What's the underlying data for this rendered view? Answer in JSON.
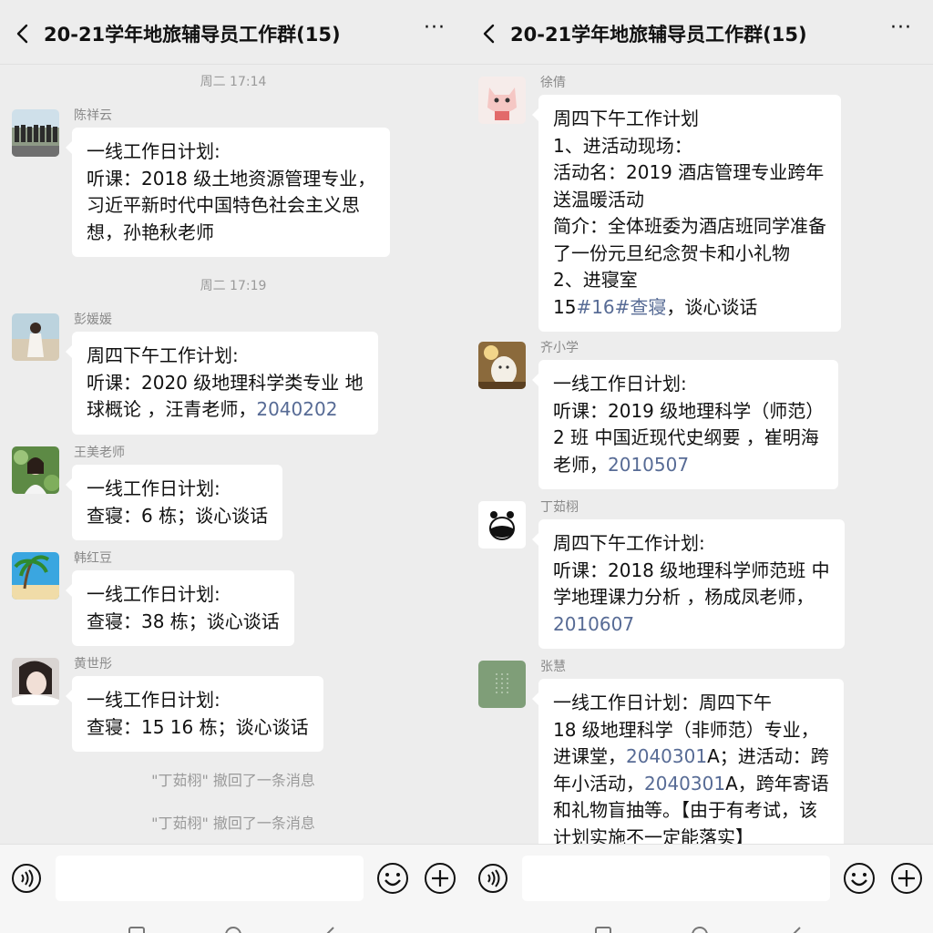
{
  "left": {
    "header": {
      "title": "20-21学年地旅辅导员工作群(15)",
      "more": "···"
    },
    "times": [
      "周二 17:14",
      "周二 17:19"
    ],
    "messages": [
      {
        "sender": "陈祥云",
        "lines": [
          [
            {
              "t": "一线工作日计划:"
            }
          ],
          [
            {
              "t": "听课：2018 级土地资源管理专业，"
            }
          ],
          [
            {
              "t": "习近平新时代中国特色社会主义思"
            }
          ],
          [
            {
              "t": "想，孙艳秋老师"
            }
          ]
        ]
      },
      {
        "sender": "彭媛媛",
        "lines": [
          [
            {
              "t": "周四下午工作计划:"
            }
          ],
          [
            {
              "t": "听课：2020 级地理科学类专业  地"
            }
          ],
          [
            {
              "t": "球概论  ，汪青老师，"
            },
            {
              "t": "2040202",
              "link": true
            }
          ]
        ]
      },
      {
        "sender": "王美老师",
        "lines": [
          [
            {
              "t": "一线工作日计划:"
            }
          ],
          [
            {
              "t": "查寝：6 栋；谈心谈话"
            }
          ]
        ]
      },
      {
        "sender": "韩红豆",
        "lines": [
          [
            {
              "t": "一线工作日计划:"
            }
          ],
          [
            {
              "t": "查寝：38 栋；谈心谈话"
            }
          ]
        ]
      },
      {
        "sender": "黄世彤",
        "lines": [
          [
            {
              "t": "一线工作日计划:"
            }
          ],
          [
            {
              "t": "查寝：15 16 栋；谈心谈话"
            }
          ]
        ]
      }
    ],
    "system": [
      "\"丁茹栩\" 撤回了一条消息",
      "\"丁茹栩\" 撤回了一条消息"
    ]
  },
  "right": {
    "header": {
      "title": "20-21学年地旅辅导员工作群(15)",
      "more": "···"
    },
    "messages": [
      {
        "sender": "徐倩",
        "lines": [
          [
            {
              "t": "周四下午工作计划"
            }
          ],
          [
            {
              "t": "1、进活动现场："
            }
          ],
          [
            {
              "t": "活动名：2019 酒店管理专业跨年"
            }
          ],
          [
            {
              "t": "送温暖活动"
            }
          ],
          [
            {
              "t": "简介：全体班委为酒店班同学准备"
            }
          ],
          [
            {
              "t": "了一份元旦纪念贺卡和小礼物"
            }
          ],
          [
            {
              "t": "2、进寝室"
            }
          ],
          [
            {
              "t": "15"
            },
            {
              "t": "#16#查寝",
              "link": true
            },
            {
              "t": "，谈心谈话"
            }
          ]
        ]
      },
      {
        "sender": "齐小学",
        "lines": [
          [
            {
              "t": "一线工作日计划:"
            }
          ],
          [
            {
              "t": "听课：2019 级地理科学（师范）"
            }
          ],
          [
            {
              "t": "2 班  中国近现代史纲要  ，崔明海"
            }
          ],
          [
            {
              "t": "老师，"
            },
            {
              "t": "2010507",
              "link": true
            }
          ]
        ]
      },
      {
        "sender": "丁茹栩",
        "lines": [
          [
            {
              "t": "周四下午工作计划:"
            }
          ],
          [
            {
              "t": "听课：2018 级地理科学师范班  中"
            }
          ],
          [
            {
              "t": "学地理课力分析  ，杨成凤老师，"
            }
          ],
          [
            {
              "t": "2010607",
              "link": true
            }
          ]
        ]
      },
      {
        "sender": "张慧",
        "lines": [
          [
            {
              "t": "一线工作日计划：周四下午"
            }
          ],
          [
            {
              "t": "18 级地理科学（非师范）专业，"
            }
          ],
          [
            {
              "t": "进课堂，"
            },
            {
              "t": "2040301",
              "link": true
            },
            {
              "t": "A；进活动：跨"
            }
          ],
          [
            {
              "t": "年小活动，"
            },
            {
              "t": "2040301",
              "link": true
            },
            {
              "t": "A，跨年寄语"
            }
          ],
          [
            {
              "t": "和礼物盲抽等。【由于有考试，该"
            }
          ],
          [
            {
              "t": "计划实施不一定能落实】"
            }
          ]
        ]
      }
    ]
  },
  "colors": {
    "link": "#576b95",
    "background": "#ededed",
    "bubble": "#ffffff",
    "meta": "#9a9a9a"
  }
}
